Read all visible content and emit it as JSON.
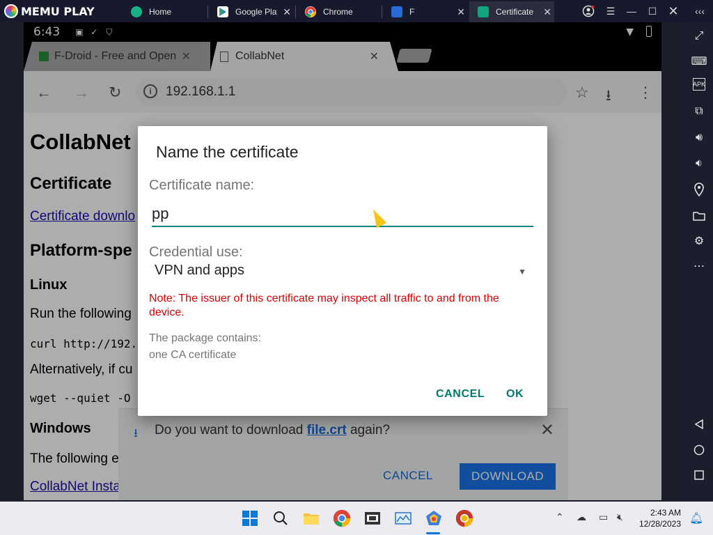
{
  "emulator": {
    "brand": "MEMU PLAY",
    "tabs": [
      {
        "label": "Home",
        "icon": "memu-home-icon",
        "color": "#17b387"
      },
      {
        "label": "Google Play",
        "icon": "play-store-icon",
        "color": "#ffffff"
      },
      {
        "label": "Chrome",
        "icon": "chrome-icon",
        "color": "#ffffff"
      },
      {
        "label": "F",
        "icon": "fdroid-icon",
        "color": "#2a6ad4"
      },
      {
        "label": "Certificate",
        "icon": "android-icon",
        "color": "#14a37f"
      }
    ]
  },
  "android": {
    "status_time": "6:43"
  },
  "browser": {
    "tabs": [
      {
        "label": "F-Droid - Free and Open"
      },
      {
        "label": "CollabNet"
      }
    ],
    "url": "192.168.1.1"
  },
  "page": {
    "h1": "CollabNet",
    "h2_certificate": "Certificate",
    "cert_link": "Certificate downlo",
    "h2_platform": "Platform-spe",
    "h3_linux": "Linux",
    "run_text": "Run the following",
    "curl_code": "curl http://192.",
    "alt_text": "Alternatively, if cu",
    "wget_code": "wget --quiet -O",
    "h3_windows": "Windows",
    "following_text": "The following e",
    "installer_link": "CollabNet Insta"
  },
  "download_bar": {
    "prefix": "Do you want to download ",
    "filename": "file.crt",
    "suffix": " again?",
    "cancel": "CANCEL",
    "download": "DOWNLOAD"
  },
  "dialog": {
    "title": "Name the certificate",
    "name_label": "Certificate name:",
    "name_value": "pp",
    "use_label": "Credential use:",
    "use_value": "VPN and apps",
    "note": "Note: The issuer of this certificate may inspect all traffic to and from the device.",
    "package_line1": "The package contains:",
    "package_line2": "one CA certificate",
    "cancel": "CANCEL",
    "ok": "OK"
  },
  "taskbar": {
    "time": "2:43 AM",
    "date": "12/28/2023"
  }
}
